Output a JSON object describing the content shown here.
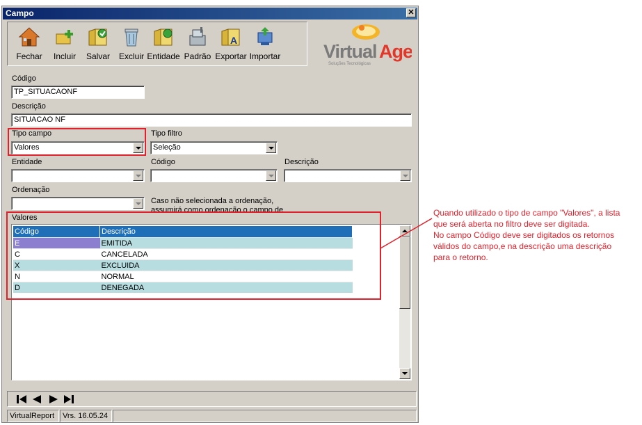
{
  "window": {
    "title": "Campo",
    "close": "✕"
  },
  "toolbar": {
    "buttons": [
      {
        "label": "Fechar",
        "icon": "home-icon"
      },
      {
        "label": "Incluir",
        "icon": "add-icon"
      },
      {
        "label": "Salvar",
        "icon": "save-icon"
      },
      {
        "label": "Excluir",
        "icon": "trash-icon"
      },
      {
        "label": "Entidade",
        "icon": "entity-icon"
      },
      {
        "label": "Padrão",
        "icon": "default-icon"
      },
      {
        "label": "Exportar",
        "icon": "export-icon"
      },
      {
        "label": "Importar",
        "icon": "import-icon"
      }
    ]
  },
  "logo": {
    "text_virtual": "Virtual",
    "text_age": "Age",
    "tagline": "Soluções Tecnológicas"
  },
  "form": {
    "codigo_label": "Código",
    "codigo_value": "TP_SITUACAONF",
    "descricao_label": "Descrição",
    "descricao_value": "SITUACAO NF",
    "tipo_campo_label": "Tipo campo",
    "tipo_campo_value": "Valores",
    "tipo_filtro_label": "Tipo filtro",
    "tipo_filtro_value": "Seleção",
    "entidade_label": "Entidade",
    "entidade_codigo_label": "Código",
    "entidade_descricao_label": "Descrição",
    "ordenacao_label": "Ordenação",
    "ordenacao_note": "Caso não selecionada a ordenação, assumirá como ordenação o campo de descrição",
    "valores_label": "Valores"
  },
  "grid": {
    "columns": [
      "Código",
      "Descrição"
    ],
    "rows": [
      {
        "codigo": "E",
        "descricao": "EMITIDA"
      },
      {
        "codigo": "C",
        "descricao": "CANCELADA"
      },
      {
        "codigo": "X",
        "descricao": "EXCLUIDA"
      },
      {
        "codigo": "N",
        "descricao": "NORMAL"
      },
      {
        "codigo": "D",
        "descricao": "DENEGADA"
      }
    ]
  },
  "navigator": {
    "buttons": [
      "first",
      "prior",
      "next",
      "last"
    ]
  },
  "status": {
    "app": "VirtualReport",
    "version": "Vrs. 16.05.24"
  },
  "annotation": {
    "lines": [
      "Quando utilizado o tipo de campo \"Valores\", a lista",
      "que será aberta no filtro deve ser digitada.",
      "No campo Código deve ser digitados os retornos",
      "válidos do campo,e na descrição uma descrição",
      "para o retorno."
    ]
  },
  "colors": {
    "highlight": "#e0202a",
    "title_bar": "#0a246a",
    "grid_header": "#1e6fb8",
    "grid_alt_row": "#b7dde0"
  }
}
